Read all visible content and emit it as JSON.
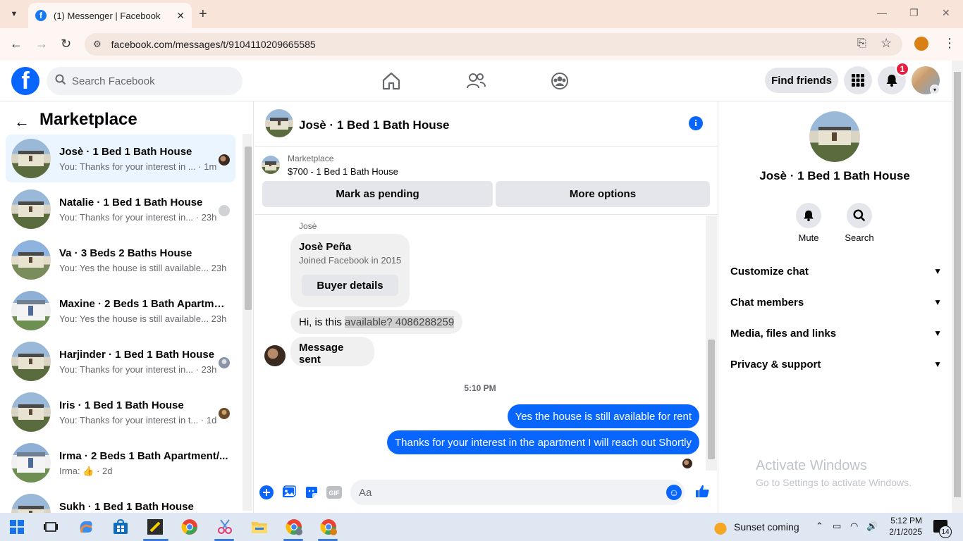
{
  "browser": {
    "tab_title": "(1) Messenger | Facebook",
    "url": "facebook.com/messages/t/9104110209665585"
  },
  "fb_header": {
    "search_placeholder": "Search Facebook",
    "find_friends": "Find friends",
    "notification_count": "1"
  },
  "sidebar": {
    "title": "Marketplace",
    "conversations": [
      {
        "name": "Josè · 1 Bed 1 Bath House",
        "snippet": "You: Thanks for your interest in ...",
        "time": "1m"
      },
      {
        "name": "Natalie · 1 Bed 1 Bath House",
        "snippet": "You: Thanks for your interest in...",
        "time": "23h"
      },
      {
        "name": "Va · 3 Beds 2 Baths House",
        "snippet": "You: Yes the house is still available...",
        "time": "23h"
      },
      {
        "name": "Maxine · 2 Beds 1 Bath Apartme...",
        "snippet": "You: Yes the house is still available...",
        "time": "23h"
      },
      {
        "name": "Harjinder · 1 Bed 1 Bath House",
        "snippet": "You: Thanks for your interest in...",
        "time": "23h"
      },
      {
        "name": "Iris · 1 Bed 1 Bath House",
        "snippet": "You: Thanks for your interest in t...",
        "time": "1d"
      },
      {
        "name": "Irma · 2 Beds 1 Bath Apartment/...",
        "snippet": "Irma:",
        "time": "2d"
      },
      {
        "name": "Sukh · 1 Bed 1 Bath House",
        "snippet": "",
        "time": ""
      }
    ]
  },
  "chat": {
    "title": "Josè · 1 Bed 1 Bath House",
    "listing_source": "Marketplace",
    "listing_price": "$700 - 1 Bed 1 Bath House",
    "mark_pending": "Mark as pending",
    "more_options": "More options",
    "sender_label": "Josè",
    "buyer_name": "Josè Peña",
    "buyer_joined": "Joined Facebook in 2015",
    "buyer_details": "Buyer details",
    "msg_in_1_prefix": "Hi, is this ",
    "msg_in_1_highlight": "available? 4086288259",
    "msg_in_2": "Message sent",
    "timestamp": "5:10 PM",
    "msg_out_1": "Yes the house is still available for rent",
    "msg_out_2": "Thanks for your interest in the apartment I will reach out Shortly",
    "input_placeholder": "Aa"
  },
  "details": {
    "name": "Josè · 1 Bed 1 Bath House",
    "mute": "Mute",
    "search": "Search",
    "sections": [
      "Customize chat",
      "Chat members",
      "Media, files and links",
      "Privacy & support"
    ]
  },
  "watermark": {
    "title": "Activate Windows",
    "subtitle": "Go to Settings to activate Windows."
  },
  "taskbar": {
    "weather": "Sunset coming",
    "time": "5:12 PM",
    "date": "2/1/2025",
    "notifications": "14"
  },
  "colors": {
    "fb_blue": "#0866ff",
    "outgoing_bubble": "#0866ff",
    "incoming_bubble": "#f0f0f0",
    "notification_red": "#e41e3f"
  }
}
